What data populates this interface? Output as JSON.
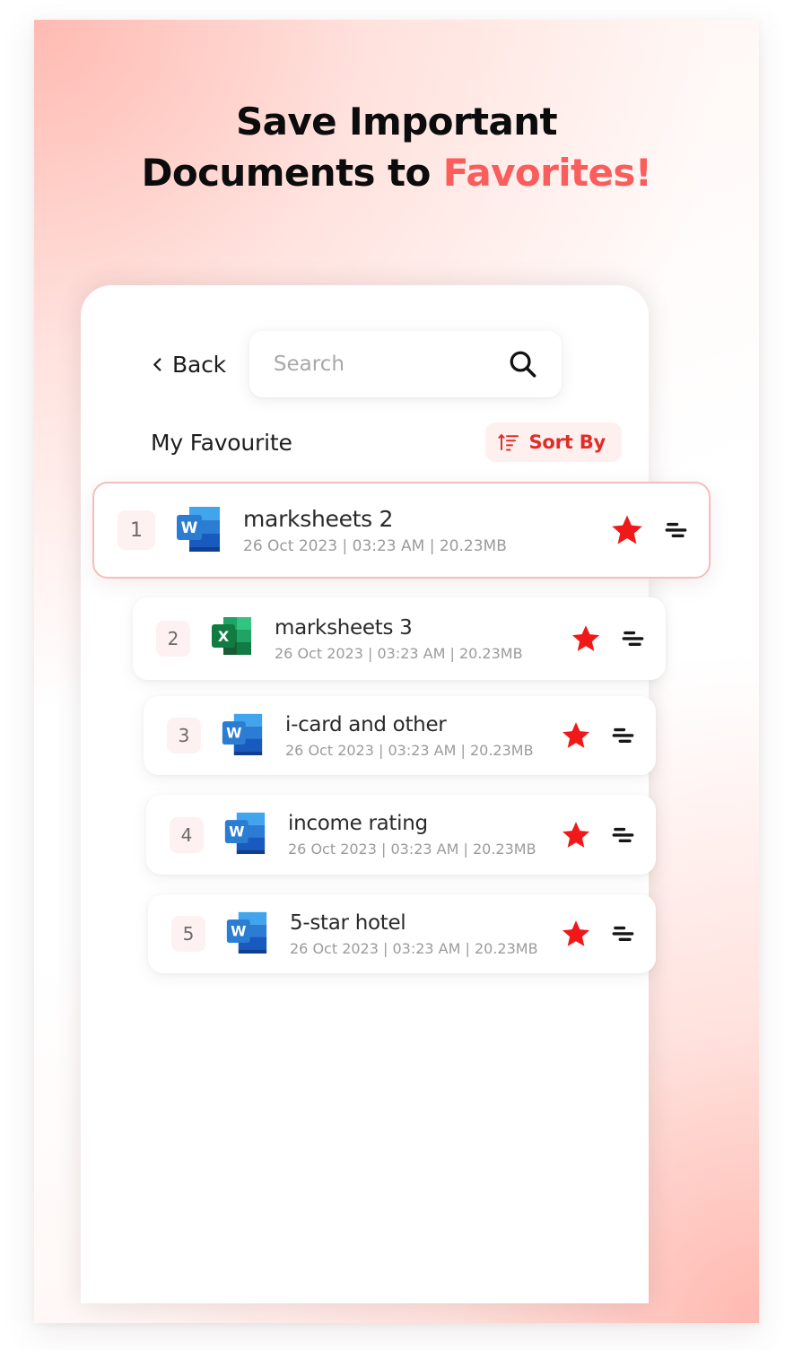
{
  "headline": {
    "line1": "Save Important",
    "line2_plain": "Documents to ",
    "line2_accent": "Favorites!"
  },
  "topbar": {
    "back_label": "Back",
    "back_icon": "chevron-left-icon",
    "search_placeholder": "Search",
    "search_value": "",
    "search_icon": "search-icon"
  },
  "section": {
    "title": "My Favourite",
    "sort_label": "Sort By",
    "sort_icon": "sort-ascending-icon"
  },
  "colors": {
    "accent_red": "#fb5c5c",
    "sort_red": "#e12d27",
    "star_red": "#f01818",
    "featured_border": "#f6bdbd",
    "rank_bg": "#fdf1f1",
    "word_blue": "#2b7cd3",
    "excel_green": "#1d8a4e"
  },
  "files": [
    {
      "rank": "1",
      "name": "marksheets 2",
      "details": "26 Oct 2023 | 03:23 AM | 20.23MB",
      "type": "word",
      "icon": "word-document-icon",
      "favorite": true,
      "featured": true
    },
    {
      "rank": "2",
      "name": "marksheets 3",
      "details": "26 Oct 2023 | 03:23 AM | 20.23MB",
      "type": "excel",
      "icon": "excel-spreadsheet-icon",
      "favorite": true,
      "featured": false
    },
    {
      "rank": "3",
      "name": "i-card and other",
      "details": "26 Oct 2023 | 03:23 AM | 20.23MB",
      "type": "word",
      "icon": "word-document-icon",
      "favorite": true,
      "featured": false
    },
    {
      "rank": "4",
      "name": "income rating",
      "details": "26 Oct 2023 | 03:23 AM | 20.23MB",
      "type": "word",
      "icon": "word-document-icon",
      "favorite": true,
      "featured": false
    },
    {
      "rank": "5",
      "name": "5-star hotel",
      "details": "26 Oct 2023 | 03:23 AM | 20.23MB",
      "type": "word",
      "icon": "word-document-icon",
      "favorite": true,
      "featured": false
    }
  ],
  "row_icons": {
    "star": "star-filled-icon",
    "menu": "row-options-icon"
  }
}
